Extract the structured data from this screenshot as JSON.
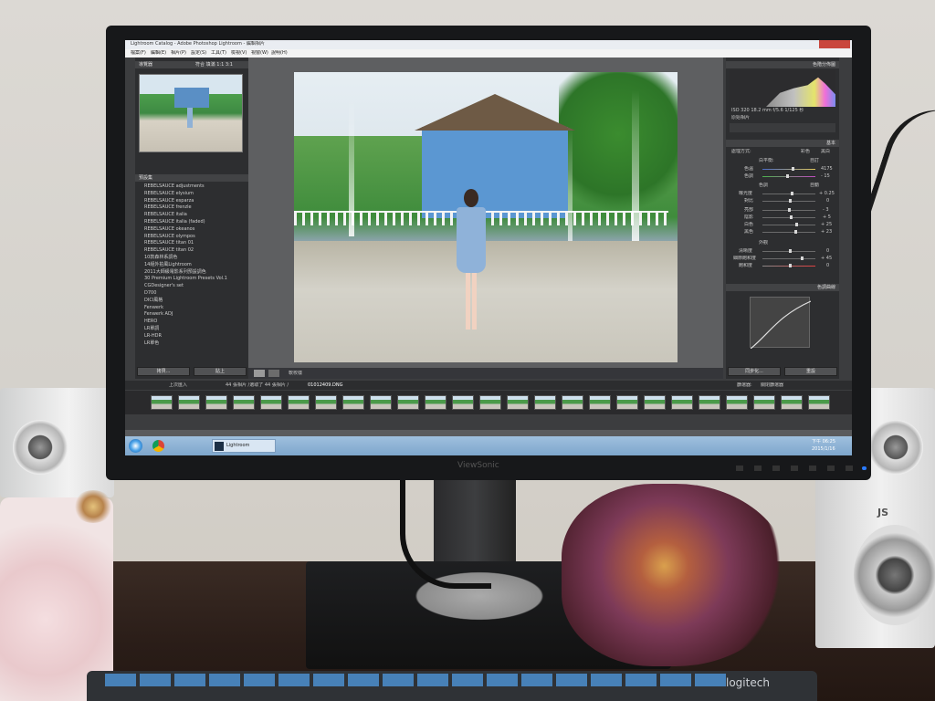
{
  "monitor": {
    "brand": "ViewSonic"
  },
  "lightroom": {
    "title": "Lightroom Catalog - Adobe Photoshop Lightroom - 編輯相片",
    "menus": [
      "檔案(F)",
      "編輯(E)",
      "相片(P)",
      "設定(S)",
      "工具(T)",
      "檢視(V)",
      "視窗(W)",
      "說明(H)"
    ],
    "navigator": {
      "label": "導覽器",
      "zoom": [
        "符合",
        "填滿",
        "1:1",
        "3:1"
      ]
    },
    "presets": {
      "label": "預設集",
      "items": [
        "REBELSAUCE adjustments",
        "REBELSAUCE elysium",
        "REBELSAUCE esparza",
        "REBELSAUCE frenzle",
        "REBELSAUCE italia",
        "REBELSAUCE italia (faded)",
        "REBELSAUCE okeanos",
        "REBELSAUCE olympos",
        "REBELSAUCE titan 01",
        "REBELSAUCE titan 02",
        "10款森林系調色",
        "14組外拍風Lightroom",
        "2011大師級電影系列預設調色",
        "30 Premium Lightroom Presets Vol.1",
        "CGDesigner's set",
        "D700",
        "DICI風格",
        "Fenwerk",
        "Fenwerk ADJ",
        "HERO",
        "LR單調",
        "LR-HDR",
        "LR單色"
      ],
      "copy_button": "拷貝...",
      "paste_button": "貼上"
    },
    "histogram": {
      "label": "色階分佈圖",
      "iso": "ISO 320",
      "focal": "18.2 mm",
      "aperture": "f/5.6",
      "shutter": "1/125 秒",
      "original_photo": "原始相片"
    },
    "basic": {
      "label": "基本",
      "treatment": "處理方式:",
      "color": "彩色",
      "bw": "黑白",
      "wb_label": "白平衡:",
      "wb_value": "自訂",
      "temp_label": "色溫",
      "temp_value": "4175",
      "tint_label": "色調",
      "tint_value": "- 15",
      "tone_label": "色調",
      "tone_auto": "自動",
      "exposure_label": "曝光度",
      "exposure_value": "+ 0.25",
      "contrast_label": "對比",
      "contrast_value": "0",
      "highlights_label": "亮部",
      "highlights_value": "- 3",
      "shadows_label": "陰影",
      "shadows_value": "+ 5",
      "whites_label": "白色",
      "whites_value": "+ 25",
      "blacks_label": "黑色",
      "blacks_value": "+ 23",
      "presence_label": "外觀",
      "clarity_label": "清晰度",
      "clarity_value": "0",
      "vibrance_label": "細節飽和度",
      "vibrance_value": "+ 45",
      "saturation_label": "飽和度",
      "saturation_value": "0"
    },
    "tone_curve": {
      "label": "色調曲線"
    },
    "sync_button": "同步化...",
    "reset_button": "重設",
    "toolbar": {
      "softproof": "軟校樣"
    },
    "filmstrip_bar": {
      "source_prev": "上次匯入",
      "info": "44 張相片 /選取了 44 張相片 /",
      "filename": "01012409.DNG",
      "filter_label": "篩選器:",
      "filter_value": "關閉篩選器"
    }
  },
  "taskbar": {
    "time": "下午 06:25",
    "date": "2015/1/16",
    "ie_label": "Lightroom"
  },
  "keyboard": {
    "brand": "logitech"
  },
  "speaker": {
    "brand": "JS"
  }
}
